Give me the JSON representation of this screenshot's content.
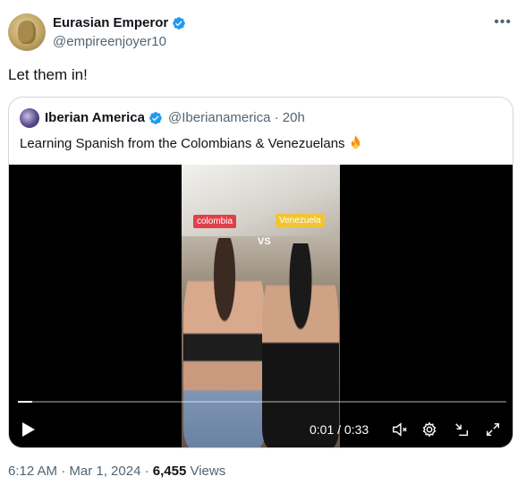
{
  "tweet": {
    "author_name": "Eurasian Emperor",
    "author_handle": "@empireenjoyer10",
    "text": "Let them in!",
    "timestamp": "6:12 AM · Mar 1, 2024 · ",
    "views_count": "6,455",
    "views_label": " Views"
  },
  "quoted": {
    "author_name": "Iberian America",
    "author_handle": "@Iberianamerica · 20h",
    "text": "Learning Spanish from the Colombians & Venezuelans",
    "video": {
      "tag_left": "colombia",
      "tag_vs": "VS",
      "tag_right": "Venezuela",
      "time": "0:01 / 0:33",
      "progress": 0.03
    }
  },
  "colors": {
    "verified": "#1d9bf0",
    "muted_text": "#536471"
  },
  "icons": [
    "verified-badge-icon",
    "more-icon",
    "fire-icon",
    "play-icon",
    "mute-icon",
    "settings-icon",
    "minimize-icon",
    "fullscreen-icon"
  ]
}
